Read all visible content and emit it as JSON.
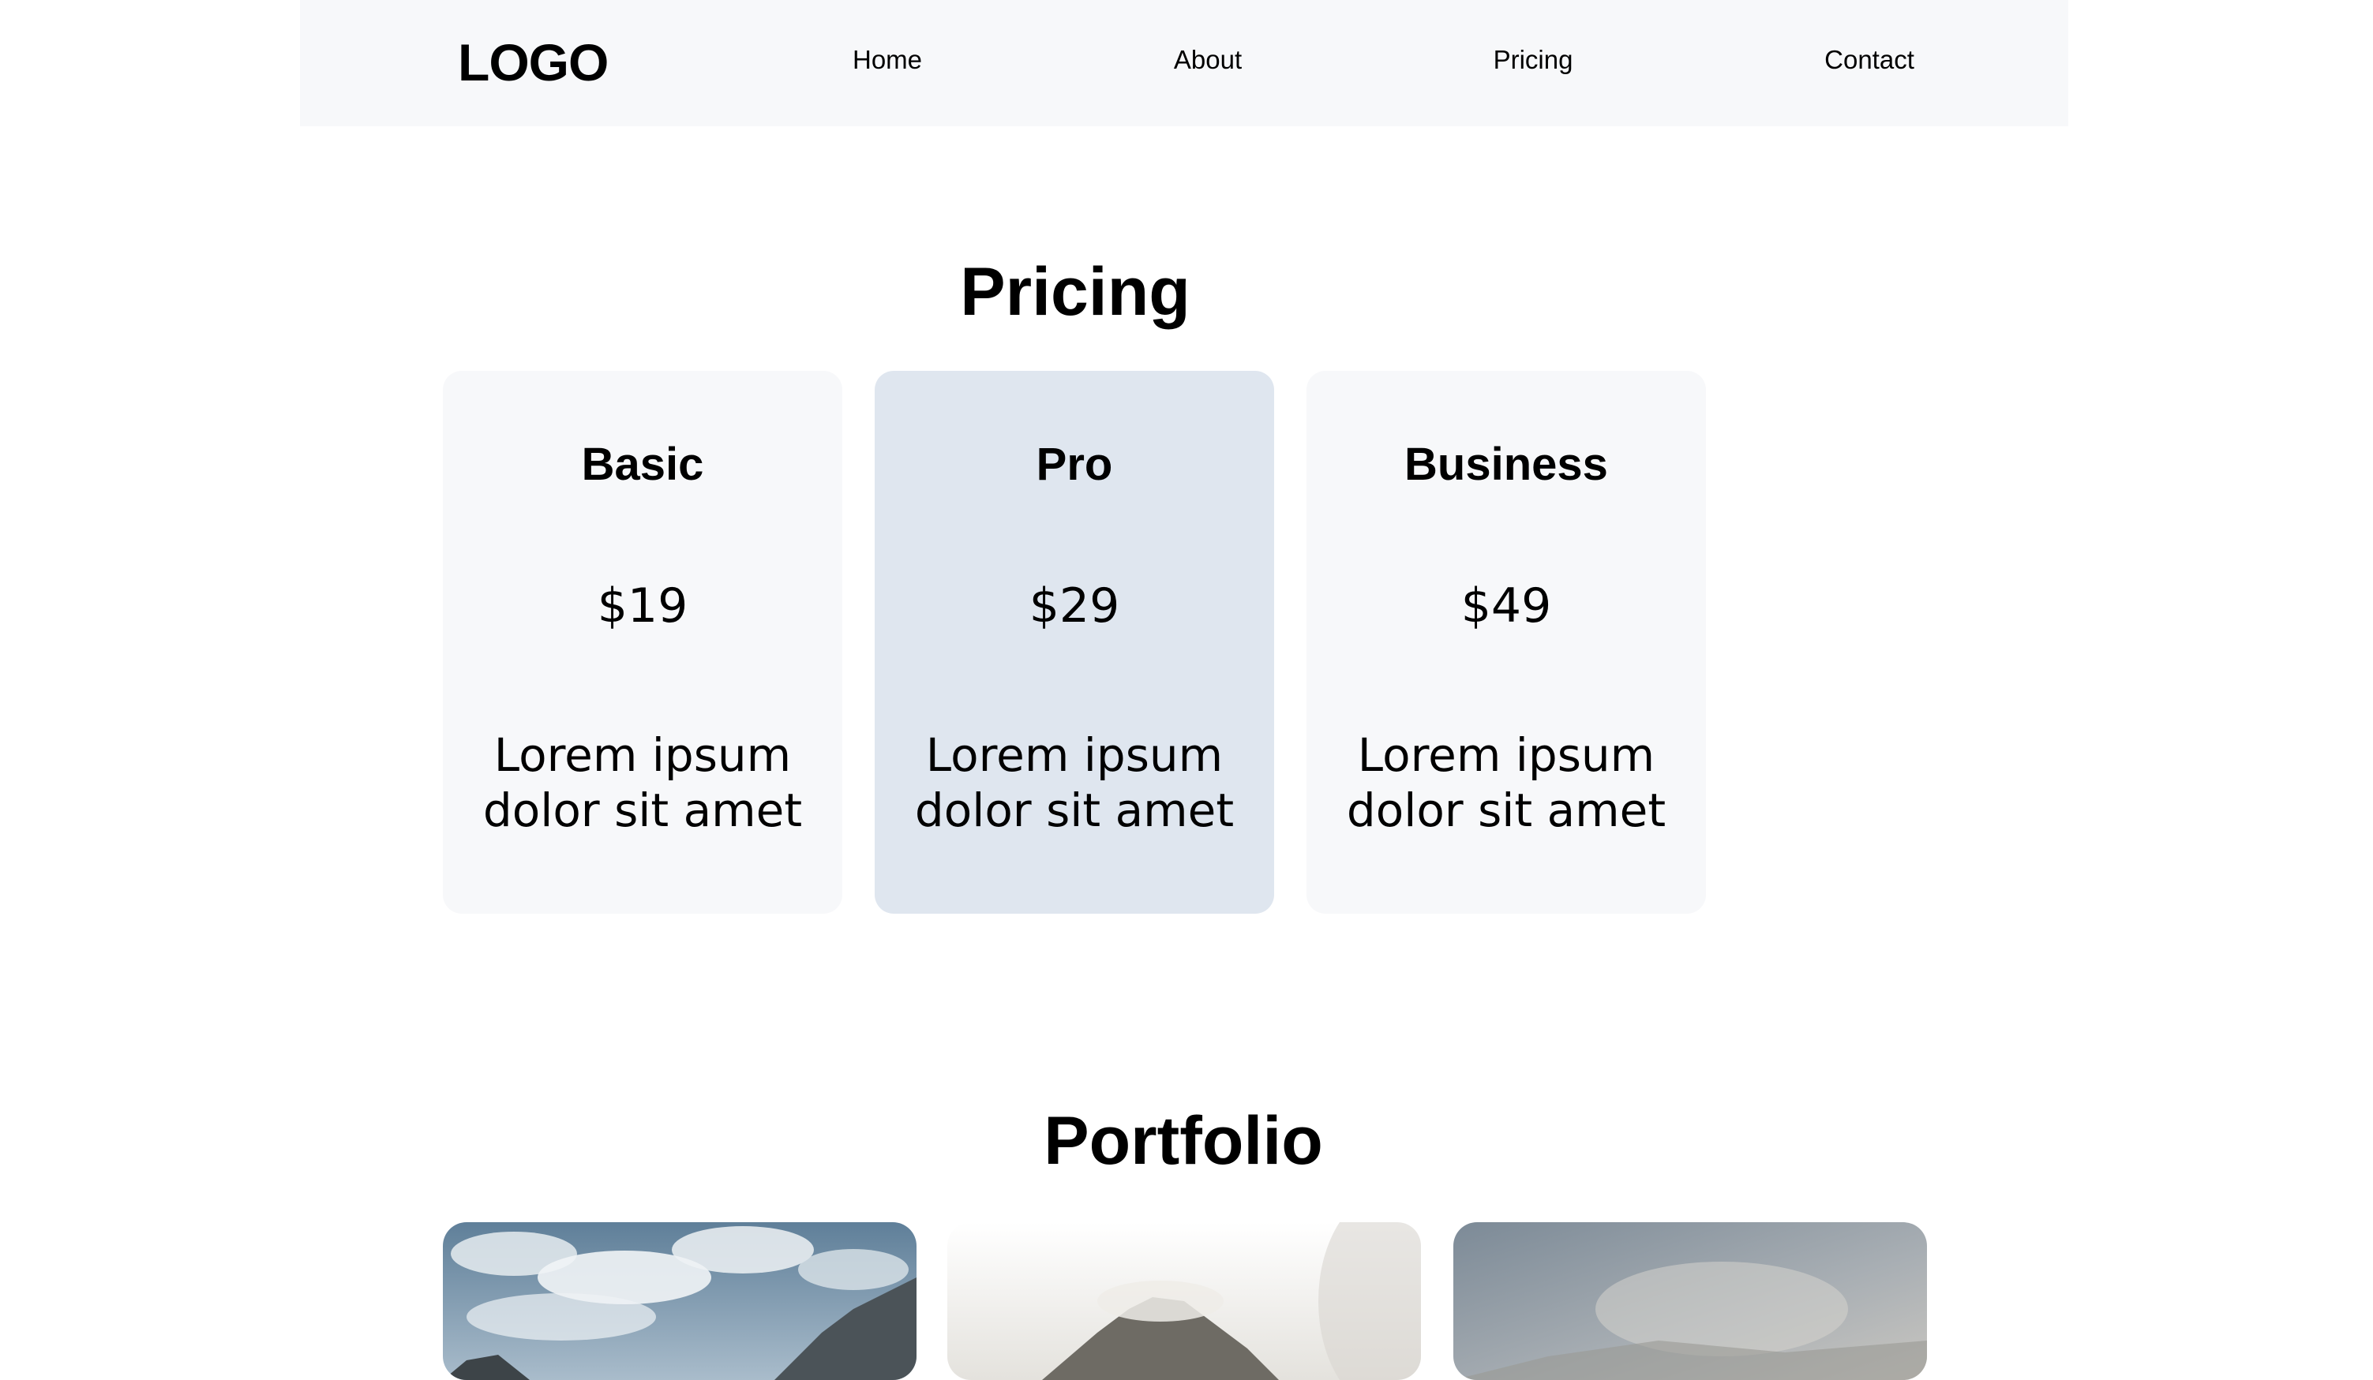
{
  "nav": {
    "logo": "LOGO",
    "links": [
      {
        "label": "Home"
      },
      {
        "label": "About"
      },
      {
        "label": "Pricing"
      },
      {
        "label": "Contact"
      }
    ]
  },
  "pricing": {
    "title": "Pricing",
    "plans": [
      {
        "name": "Basic",
        "price": "$19",
        "description": "Lorem ipsum dolor sit amet",
        "highlighted": false
      },
      {
        "name": "Pro",
        "price": "$29",
        "description": "Lorem ipsum dolor sit amet",
        "highlighted": true
      },
      {
        "name": "Business",
        "price": "$49",
        "description": "Lorem ipsum dolor sit amet",
        "highlighted": false
      }
    ]
  },
  "portfolio": {
    "title": "Portfolio",
    "items": [
      {
        "image": "mountain-clouds-photo"
      },
      {
        "image": "foggy-peak-photo"
      },
      {
        "image": "hazy-mountain-photo"
      }
    ]
  },
  "colors": {
    "nav_background": "#f7f8fa",
    "card_background": "#f7f8fa",
    "card_highlight": "#dfe6ef",
    "text": "#000000"
  }
}
